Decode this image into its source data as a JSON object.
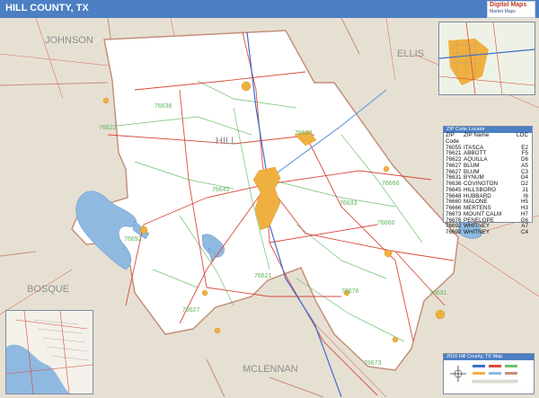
{
  "header": {
    "title": "HILL COUNTY, TX",
    "logo_line1": "Digital Maps",
    "logo_line2": "Market Maps"
  },
  "colors": {
    "header_blue": "#4c7fc3",
    "county_fill": "#ffffff",
    "surrounding_fill": "#e6e0d3",
    "water": "#8fb9e0",
    "urban": "#f0b040",
    "highway": "#d94a3c",
    "zip_boundary": "#6fc26f",
    "county_boundary": "#c58f7b"
  },
  "map": {
    "county_labels": [
      "JOHNSON",
      "ELLIS",
      "HILL",
      "BOSQUE",
      "MCLENNAN"
    ],
    "zip_labels": [
      "76636",
      "76622",
      "76645",
      "76666",
      "76633",
      "76660",
      "76692",
      "76621",
      "76676",
      "76627",
      "76673",
      "76631",
      "76623"
    ]
  },
  "zip_table": {
    "header": "ZIP Code Locator",
    "columns": [
      "ZIP Code",
      "ZIP Name",
      "LOC"
    ],
    "rows": [
      [
        "76055",
        "ITASCA",
        "E2"
      ],
      [
        "76621",
        "ABBOTT",
        "F5"
      ],
      [
        "76622",
        "AQUILLA",
        "D6"
      ],
      [
        "76627",
        "BLUM",
        "A5"
      ],
      [
        "76627",
        "BLUM",
        "C3"
      ],
      [
        "76631",
        "BYNUM",
        "G4"
      ],
      [
        "76636",
        "COVINGTON",
        "D2"
      ],
      [
        "76645",
        "HILLSBORO",
        "J1"
      ],
      [
        "76648",
        "HUBBARD",
        "I6"
      ],
      [
        "76660",
        "MALONE",
        "H5"
      ],
      [
        "76666",
        "MERTENS",
        "H3"
      ],
      [
        "76673",
        "MOUNT CALM",
        "H7"
      ],
      [
        "76676",
        "PENELOPE",
        "G6"
      ],
      [
        "76692",
        "WHITNEY",
        "A7"
      ],
      [
        "76692",
        "WHITNEY",
        "C4"
      ]
    ]
  },
  "legend": {
    "header": "2016 Hill County, TX Map"
  }
}
